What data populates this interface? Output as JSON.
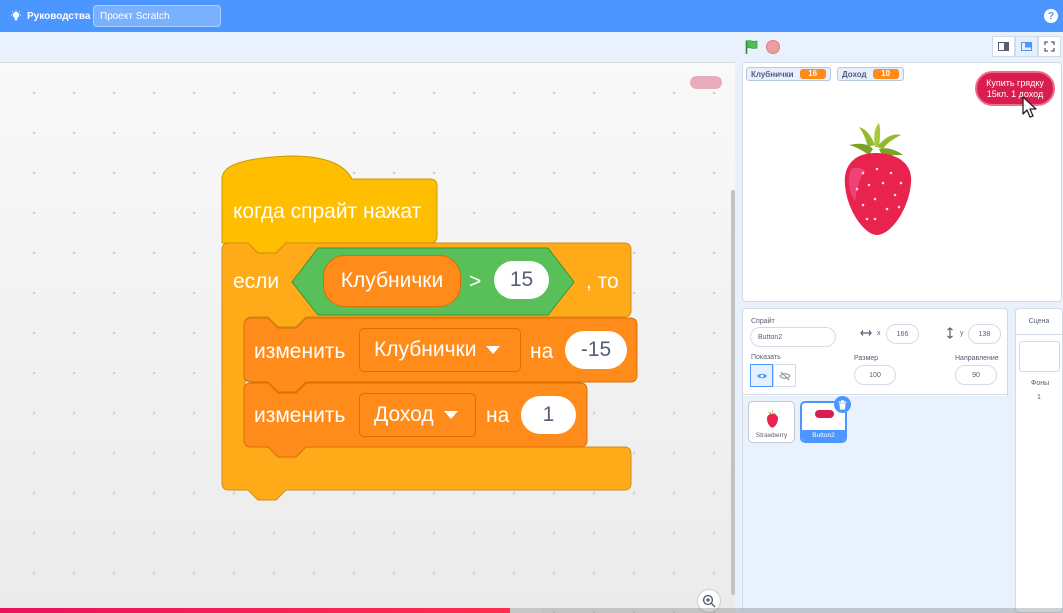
{
  "menubar": {
    "tutorials_label": "Руководства",
    "project_title": "Проект Scratch",
    "help_icon": "question-icon"
  },
  "code": {
    "hat_label": "когда спрайт нажат",
    "if_label": "если",
    "then_label": ", то",
    "condition": {
      "variable": "Клубнички",
      "operator": ">",
      "value": "15"
    },
    "change1": {
      "label": "изменить",
      "variable": "Клубнички",
      "by": "на",
      "value": "-15"
    },
    "change2": {
      "label": "изменить",
      "variable": "Доход",
      "by": "на",
      "value": "1"
    },
    "colors": {
      "events": "#ffbf00",
      "control": "#ffab19",
      "operators": "#59c059",
      "variables": "#ff8c1a"
    }
  },
  "stage": {
    "monitors": [
      {
        "label": "Клубнички",
        "value": "16"
      },
      {
        "label": "Доход",
        "value": "10"
      }
    ],
    "buy_button": {
      "line1": "Купить грядку",
      "line2": "15кл.  1 доход"
    }
  },
  "sprite_info": {
    "sprite_label": "Спрайт",
    "sprite_name": "Button2",
    "x_label": "x",
    "x_value": "166",
    "y_label": "y",
    "y_value": "138",
    "show_label": "Показать",
    "size_label": "Размер",
    "size_value": "100",
    "direction_label": "Направление",
    "direction_value": "90"
  },
  "sprites": [
    {
      "name": "Strawberry",
      "selected": false
    },
    {
      "name": "Button2",
      "selected": true
    }
  ],
  "stage_target": {
    "label": "Сцена",
    "backdrops_label": "Фоны",
    "backdrops_count": "1"
  },
  "video": {
    "progress": 0.48,
    "buffered": 0.51
  }
}
